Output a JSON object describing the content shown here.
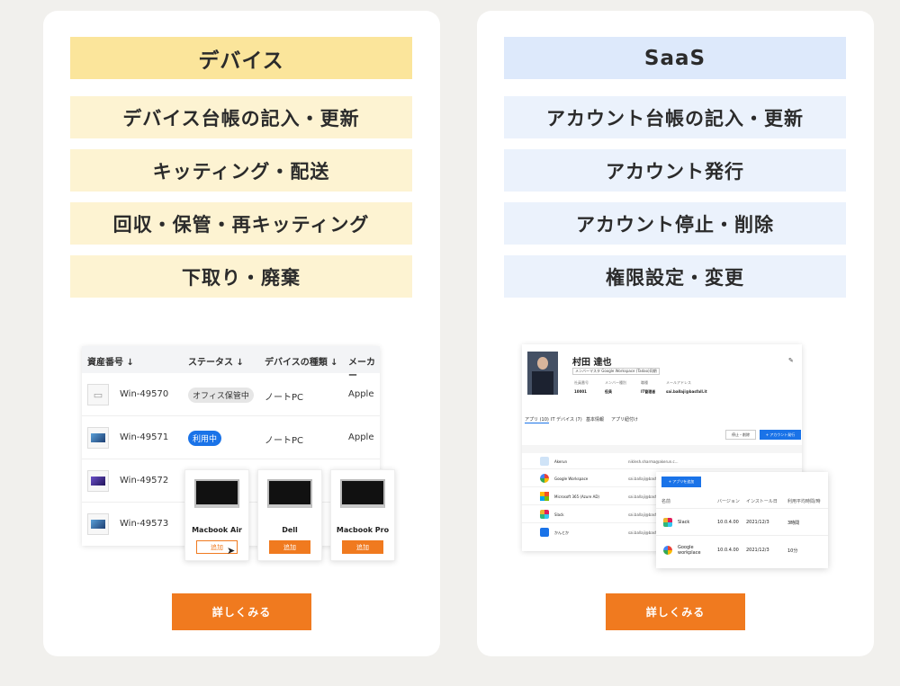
{
  "device": {
    "title": "デバイス",
    "items": [
      "デバイス台帳の記入・更新",
      "キッティング・配送",
      "回収・保管・再キッティング",
      "下取り・廃棄"
    ],
    "cta": "詳しくみる",
    "table": {
      "headers": [
        "資産番号 ↓",
        "ステータス ↓",
        "デバイスの種類 ↓",
        "メーカー"
      ],
      "rows": [
        {
          "asset": "Win-49570",
          "status": "オフィス保管中",
          "type": "ノートPC",
          "maker": "Apple"
        },
        {
          "asset": "Win-49571",
          "status": "利用中",
          "type": "ノートPC",
          "maker": "Apple"
        },
        {
          "asset": "Win-49572"
        },
        {
          "asset": "Win-49573"
        }
      ]
    },
    "picker": [
      {
        "name": "Macbook Air",
        "add": "追加"
      },
      {
        "name": "Dell",
        "add": "追加"
      },
      {
        "name": "Macbook Pro",
        "add": "追加"
      }
    ]
  },
  "saas": {
    "title": "SaaS",
    "items": [
      "アカウント台帳の記入・更新",
      "アカウント発行",
      "アカウント停止・削除",
      "権限設定・変更"
    ],
    "cta": "詳しくみる",
    "profile": {
      "name": "村田 達也",
      "tag": "メンバーマスタ Google Workspace (Tadao)同期",
      "info_labels": [
        "社員番号",
        "メンバー種別",
        "職種",
        "メールアドレス"
      ],
      "info_values": [
        "10001",
        "役員",
        "IT管理者",
        "sai.ballaji@basfall.it"
      ]
    },
    "tabs": [
      "アプリ (10)",
      "IT デバイス (7)",
      "基本情報",
      "アプリ紐付け"
    ],
    "buttons": {
      "stop": "停止・削除",
      "issue": "+ アカウント発行"
    },
    "apps": [
      {
        "name": "Akerun",
        "mail": "niklesh.sharma@akerun.c..."
      },
      {
        "name": "Google Workspace",
        "mail": "sai.ballaji@basfall..."
      },
      {
        "name": "Microsoft 365 (Azure AD)",
        "mail": "sai.ballaji@basfall..."
      },
      {
        "name": "Slack",
        "mail": "sai.ballaji@basfall..."
      },
      {
        "name": "かんとか",
        "mail": "sai.ballaji@basfall..."
      }
    ],
    "popup": {
      "add_button": "+ アプリを追加",
      "headers": [
        "名前",
        "バージョン",
        "インストール日",
        "利用平均時間/時"
      ],
      "rows": [
        {
          "name": "Slack",
          "version": "10.0.4.00",
          "date": "2021/12/3",
          "usage": "3時間"
        },
        {
          "name": "Google workplace",
          "version": "10.0.4.00",
          "date": "2021/12/3",
          "usage": "10分"
        }
      ]
    }
  }
}
